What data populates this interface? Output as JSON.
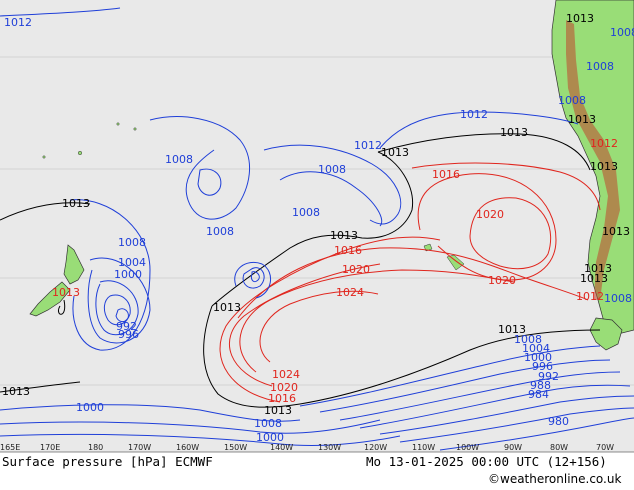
{
  "map": {
    "title": "Surface pressure [hPa] ECMWF",
    "valid_time": "Mo 13-01-2025 00:00 UTC (12+156)",
    "credit": "©weatheronline.co.uk",
    "colors": {
      "ocean": "#e9e9e9",
      "land": "#99dd77",
      "high_isobar": "#e0261e",
      "low_isobar": "#1f3fd8",
      "standard_isobar": "#000000",
      "coast": "#333333"
    },
    "longitude_ticks": [
      "165E",
      "170E",
      "180",
      "170W",
      "160W",
      "150W",
      "140W",
      "130W",
      "120W",
      "110W",
      "100W",
      "90W",
      "80W",
      "70W"
    ],
    "labels": [
      {
        "text": "1012",
        "color": "blue"
      },
      {
        "text": "1013",
        "color": "black"
      },
      {
        "text": "1008",
        "color": "blue"
      },
      {
        "text": "1012",
        "color": "blue"
      },
      {
        "text": "1013",
        "color": "black"
      },
      {
        "text": "1008",
        "color": "blue"
      },
      {
        "text": "1008",
        "color": "blue"
      },
      {
        "text": "1008",
        "color": "blue"
      },
      {
        "text": "1013",
        "color": "black"
      },
      {
        "text": "1016",
        "color": "red"
      },
      {
        "text": "1020",
        "color": "red"
      },
      {
        "text": "1024",
        "color": "red"
      },
      {
        "text": "1020",
        "color": "red"
      },
      {
        "text": "1016",
        "color": "red"
      },
      {
        "text": "1020",
        "color": "red"
      },
      {
        "text": "1013",
        "color": "black"
      },
      {
        "text": "1012",
        "color": "blue"
      },
      {
        "text": "1013",
        "color": "black"
      },
      {
        "text": "1008",
        "color": "blue"
      },
      {
        "text": "1004",
        "color": "blue"
      },
      {
        "text": "1000",
        "color": "blue"
      },
      {
        "text": "996",
        "color": "blue"
      },
      {
        "text": "992",
        "color": "blue"
      },
      {
        "text": "1013",
        "color": "red"
      },
      {
        "text": "1013",
        "color": "black"
      },
      {
        "text": "1024",
        "color": "red"
      },
      {
        "text": "1020",
        "color": "red"
      },
      {
        "text": "1016",
        "color": "red"
      },
      {
        "text": "1013",
        "color": "black"
      },
      {
        "text": "1008",
        "color": "blue"
      },
      {
        "text": "1000",
        "color": "blue"
      },
      {
        "text": "1000",
        "color": "blue"
      },
      {
        "text": "1013",
        "color": "black"
      },
      {
        "text": "1008",
        "color": "blue"
      },
      {
        "text": "1004",
        "color": "blue"
      },
      {
        "text": "1000",
        "color": "blue"
      },
      {
        "text": "996",
        "color": "blue"
      },
      {
        "text": "992",
        "color": "blue"
      },
      {
        "text": "988",
        "color": "blue"
      },
      {
        "text": "984",
        "color": "blue"
      },
      {
        "text": "980",
        "color": "blue"
      },
      {
        "text": "1013",
        "color": "black"
      },
      {
        "text": "1008",
        "color": "blue"
      },
      {
        "text": "1013",
        "color": "black"
      },
      {
        "text": "1008",
        "color": "blue"
      },
      {
        "text": "1013",
        "color": "black"
      },
      {
        "text": "1012",
        "color": "red"
      },
      {
        "text": "1013",
        "color": "black"
      },
      {
        "text": "1013",
        "color": "black"
      },
      {
        "text": "1008",
        "color": "blue"
      },
      {
        "text": "1013",
        "color": "black"
      },
      {
        "text": "1012",
        "color": "red"
      },
      {
        "text": "1008",
        "color": "blue"
      }
    ]
  }
}
